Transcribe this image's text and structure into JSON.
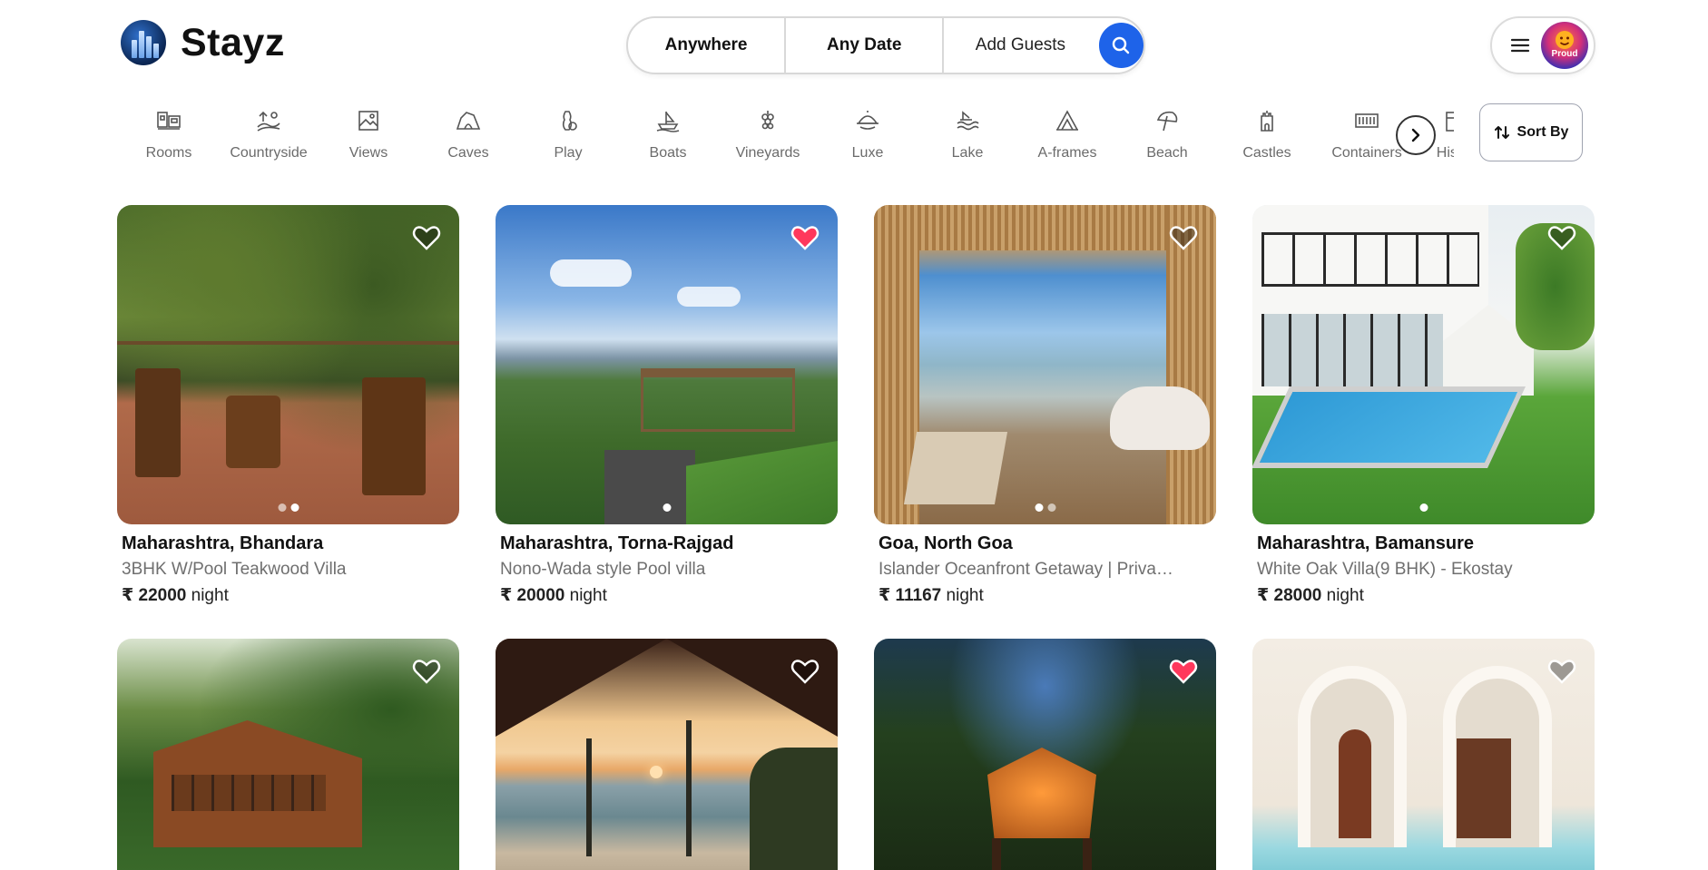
{
  "brand": {
    "name": "Stayz"
  },
  "search": {
    "where_label": "Anywhere",
    "date_label": "Any Date",
    "guests_label": "Add Guests",
    "accent": "#1e63e9"
  },
  "user_menu": {
    "avatar_text": "Proud"
  },
  "categories": [
    {
      "label": "Rooms",
      "icon": "rooms-icon"
    },
    {
      "label": "Countryside",
      "icon": "countryside-icon"
    },
    {
      "label": "Views",
      "icon": "views-icon"
    },
    {
      "label": "Caves",
      "icon": "caves-icon"
    },
    {
      "label": "Play",
      "icon": "play-icon"
    },
    {
      "label": "Boats",
      "icon": "boats-icon"
    },
    {
      "label": "Vineyards",
      "icon": "vineyards-icon"
    },
    {
      "label": "Luxe",
      "icon": "luxe-icon"
    },
    {
      "label": "Lake",
      "icon": "lake-icon"
    },
    {
      "label": "A-frames",
      "icon": "a-frames-icon"
    },
    {
      "label": "Beach",
      "icon": "beach-icon"
    },
    {
      "label": "Castles",
      "icon": "castles-icon"
    },
    {
      "label": "Containers",
      "icon": "containers-icon"
    },
    {
      "label": "Histo",
      "icon": "historic-icon"
    }
  ],
  "sort": {
    "label": "Sort By"
  },
  "currency_symbol": "₹",
  "price_unit": "night",
  "listings": [
    {
      "title": "Maharashtra, Bhandara",
      "subtitle": "3BHK W/Pool Teakwood Villa",
      "price": "22000",
      "favorite": false
    },
    {
      "title": "Maharashtra, Torna-Rajgad",
      "subtitle": "Nono-Wada style Pool villa",
      "price": "20000",
      "favorite": true
    },
    {
      "title": "Goa, North Goa",
      "subtitle": "Islander Oceanfront Getaway | Privat...",
      "price": "11167",
      "favorite": false
    },
    {
      "title": "Maharashtra, Bamansure",
      "subtitle": "White Oak Villa(9 BHK) - Ekostay",
      "price": "28000",
      "favorite": false
    },
    {
      "favorite": false
    },
    {
      "favorite": false
    },
    {
      "favorite": true
    },
    {
      "favorite": false
    }
  ]
}
